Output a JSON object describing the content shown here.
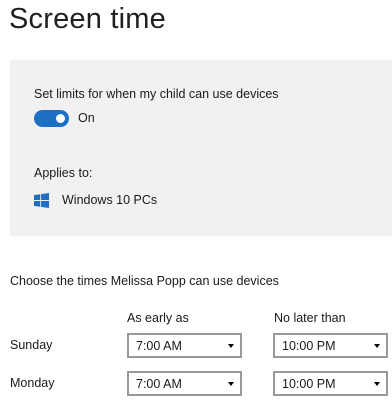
{
  "header": {
    "title": "Screen time"
  },
  "limits": {
    "label": "Set limits for when my child can use devices",
    "toggle_state": "On",
    "toggle_on": true,
    "accent_color": "#1c6fc3"
  },
  "applies": {
    "label": "Applies to:",
    "device_icon": "windows-logo-icon",
    "device": "Windows 10 PCs"
  },
  "schedule": {
    "heading": "Choose the times Melissa Popp can use devices",
    "columns": {
      "earliest": "As early as",
      "latest": "No later than"
    },
    "days": [
      {
        "day": "Sunday",
        "earliest": "7:00 AM",
        "latest": "10:00 PM"
      },
      {
        "day": "Monday",
        "earliest": "7:00 AM",
        "latest": "10:00 PM"
      }
    ]
  }
}
